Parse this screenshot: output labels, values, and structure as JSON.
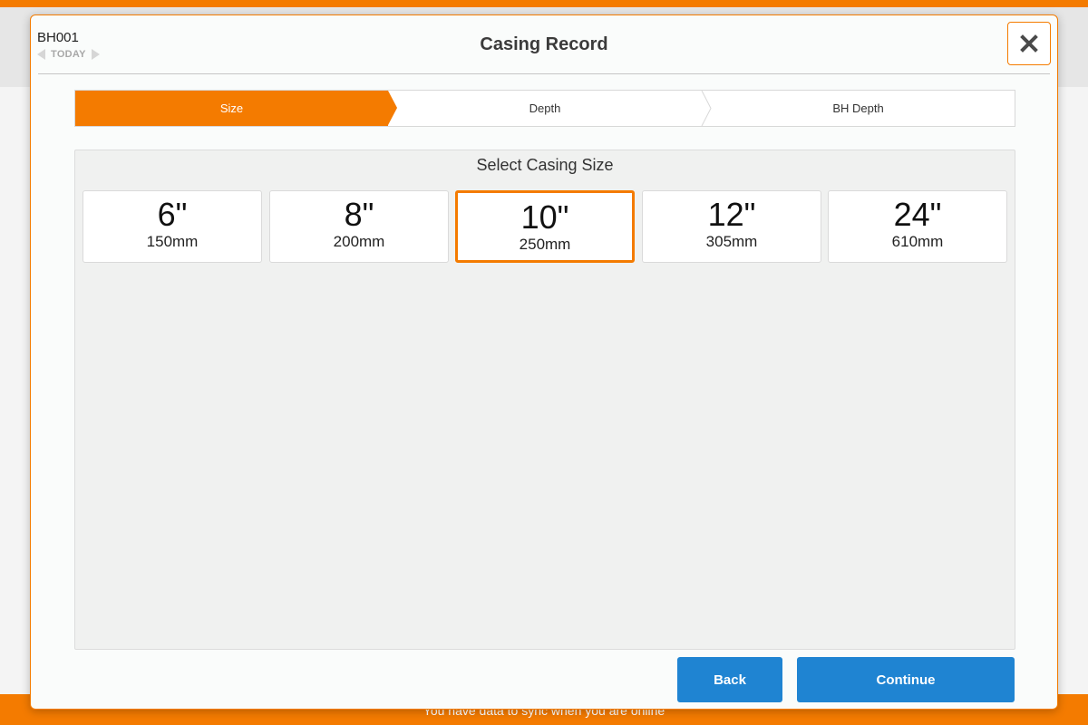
{
  "background": {
    "sync_message": "You have data to sync when you are online"
  },
  "modal": {
    "title": "Casing Record",
    "borehole_id": "BH001",
    "date_label": "TODAY",
    "close_icon": "close-icon"
  },
  "stepper": {
    "steps": [
      {
        "label": "Size",
        "active": true
      },
      {
        "label": "Depth",
        "active": false
      },
      {
        "label": "BH Depth",
        "active": false
      }
    ]
  },
  "size_panel": {
    "title": "Select Casing Size",
    "sizes": [
      {
        "inch": "6\"",
        "mm": "150mm",
        "selected": false
      },
      {
        "inch": "8\"",
        "mm": "200mm",
        "selected": false
      },
      {
        "inch": "10\"",
        "mm": "250mm",
        "selected": true
      },
      {
        "inch": "12\"",
        "mm": "305mm",
        "selected": false
      },
      {
        "inch": "24\"",
        "mm": "610mm",
        "selected": false
      }
    ]
  },
  "footer": {
    "back_label": "Back",
    "continue_label": "Continue"
  },
  "colors": {
    "accent": "#f47b00",
    "button": "#1f84d2"
  }
}
